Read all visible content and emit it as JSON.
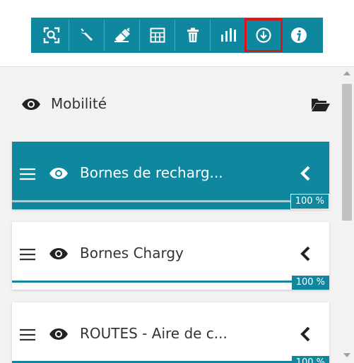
{
  "colors": {
    "accent": "#0f889f",
    "highlight": "#e0121a",
    "panel_bg": "#f2f2f2"
  },
  "toolbar": {
    "buttons": [
      {
        "icon": "zoom-extent-icon"
      },
      {
        "icon": "wrench-icon"
      },
      {
        "icon": "eraser-icon"
      },
      {
        "icon": "table-icon"
      },
      {
        "icon": "trash-icon"
      },
      {
        "icon": "bar-chart-icon"
      },
      {
        "icon": "download-icon",
        "highlighted": true
      },
      {
        "icon": "info-icon"
      }
    ]
  },
  "group": {
    "title": "Mobilité",
    "visible": true
  },
  "layers": [
    {
      "name": "Bornes de recharg...",
      "progress": "100 %",
      "active": true
    },
    {
      "name": "Bornes Chargy",
      "progress": "100 %",
      "active": false
    },
    {
      "name": "ROUTES - Aire de c...",
      "progress": "100 %",
      "active": false
    }
  ]
}
